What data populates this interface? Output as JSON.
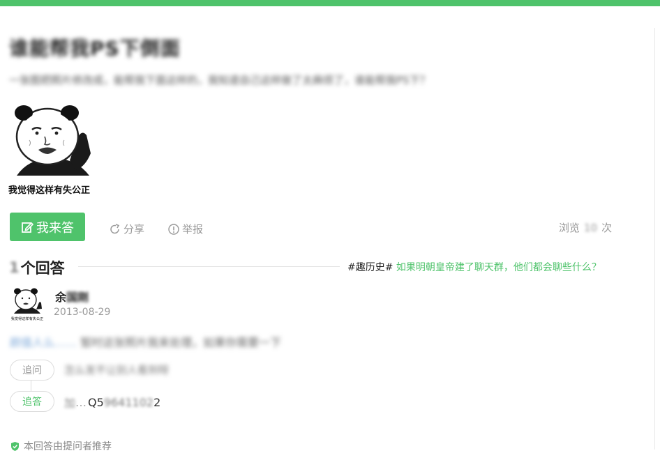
{
  "question": {
    "title": "谁能帮我PS下倒面",
    "description": "一张图把照片修改成，能帮我下面这样的，我知道自己这样做了太麻烦了，谁能帮我PS下？",
    "image_caption": "我觉得这样有失公正"
  },
  "actions": {
    "answer_label": "我来答",
    "share_label": "分享",
    "report_label": "举报",
    "views_prefix": "浏览",
    "views_count": "10",
    "views_suffix": "次"
  },
  "answers_header": {
    "count": "1",
    "label": "个回答"
  },
  "topic": {
    "tag": "#趣历史#",
    "text": "如果明朝皇帝建了聊天群，他们都会聊些什么？"
  },
  "answer": {
    "user_name_visible": "余",
    "user_name_blurred": "国刚",
    "date": "2013-08-29",
    "avatar_caption": "我觉得这样有失公正",
    "text_link": "颜值人么……",
    "text_rest": "暂时这张照片我来处理，如果你需要一下",
    "followup_ask_label": "追问",
    "followup_ask_text": "怎么发不让别人看到呀",
    "followup_reply_label": "追答",
    "followup_reply_blur1": "加",
    "followup_reply_dots": "…",
    "followup_reply_prefix": "Q5",
    "followup_reply_blur2": "9641102",
    "followup_reply_suffix": "2"
  },
  "recommend_text": "本回答由提问者推荐",
  "colors": {
    "brand_green": "#4fc36b",
    "link_blue": "#7aa6d8"
  }
}
